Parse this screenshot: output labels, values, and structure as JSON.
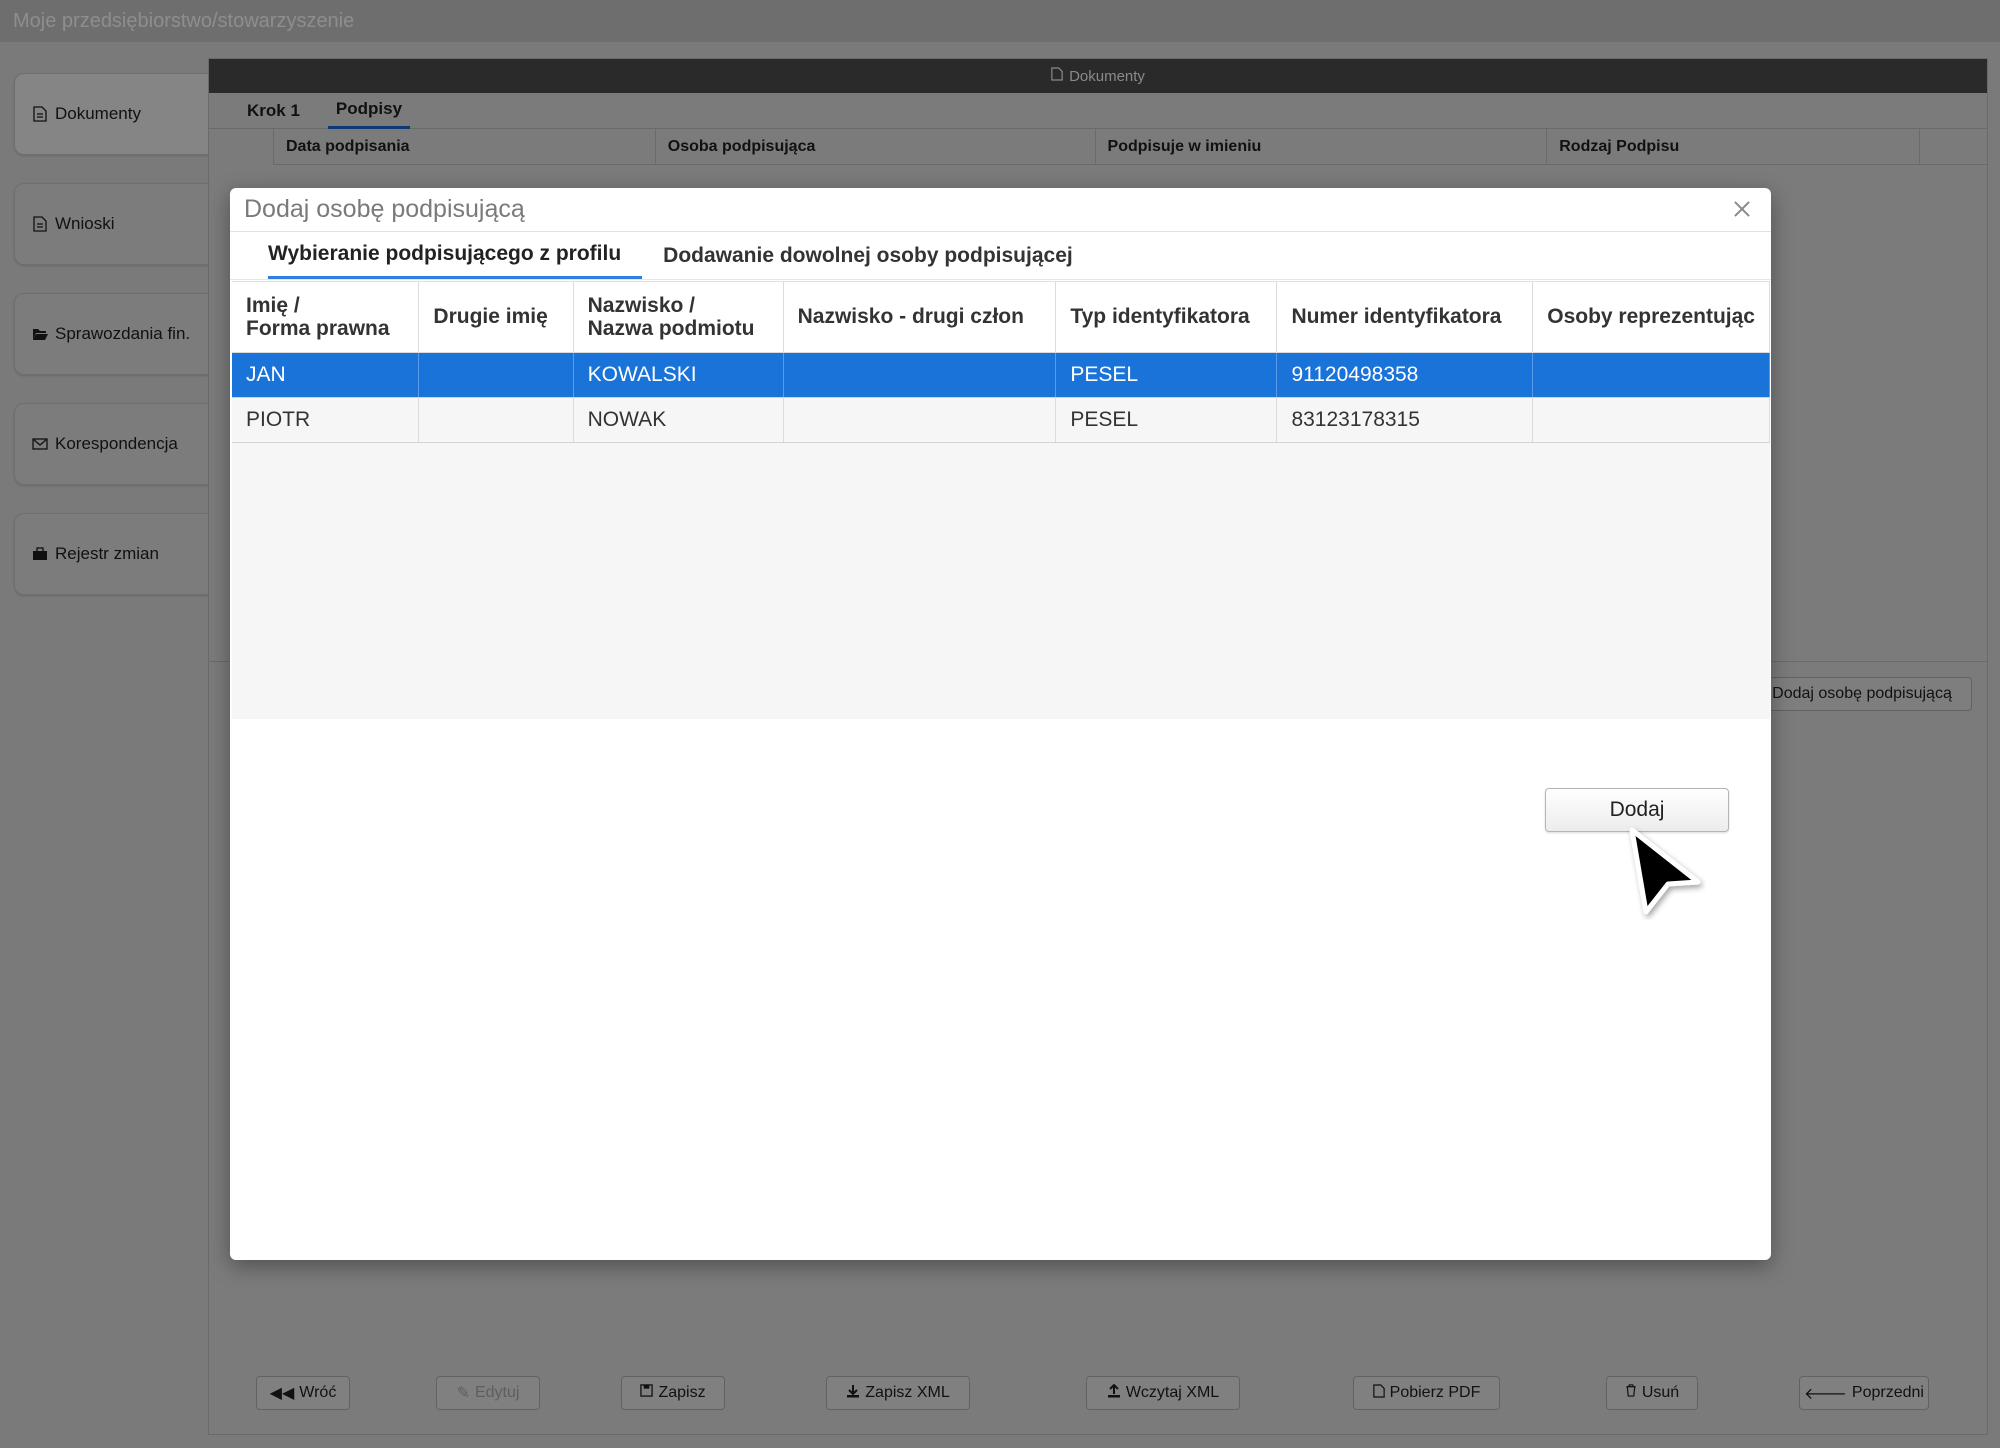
{
  "app": {
    "title": "Moje przedsiębiorstwo/stowarzyszenie"
  },
  "sidebar": {
    "items": [
      {
        "label": "Dokumenty",
        "icon": "document-icon"
      },
      {
        "label": "Wnioski",
        "icon": "document-icon"
      },
      {
        "label": "Sprawozdania fin.",
        "icon": "folder-open-icon"
      },
      {
        "label": "Korespondencja",
        "icon": "envelope-icon"
      },
      {
        "label": "Rejestr zmian",
        "icon": "briefcase-icon"
      }
    ]
  },
  "panel": {
    "header": "Dokumenty",
    "steps": [
      "Krok 1",
      "Podpisy"
    ],
    "active_step": "Podpisy",
    "columns": [
      "Data podpisania",
      "Osoba podpisująca",
      "Podpisuje w imieniu",
      "Rodzaj Podpisu"
    ],
    "add_signer_button": "Dodaj osobę podpisującą"
  },
  "footer": {
    "buttons": [
      {
        "label": "Wróć",
        "icon": "double-left-icon",
        "enabled": true
      },
      {
        "label": "Edytuj",
        "icon": "edit-icon",
        "enabled": false
      },
      {
        "label": "Zapisz",
        "icon": "save-icon",
        "enabled": true
      },
      {
        "label": "Zapisz XML",
        "icon": "download-icon",
        "enabled": true
      },
      {
        "label": "Wczytaj XML",
        "icon": "upload-icon",
        "enabled": true
      },
      {
        "label": "Pobierz PDF",
        "icon": "pdf-icon",
        "enabled": true
      },
      {
        "label": "Usuń",
        "icon": "trash-icon",
        "enabled": true
      },
      {
        "label": "Poprzedni",
        "icon": "arrow-left-icon",
        "enabled": true
      }
    ]
  },
  "modal": {
    "title": "Dodaj osobę podpisującą",
    "tabs": [
      "Wybieranie podpisującego z profilu",
      "Dodawanie dowolnej osoby podpisującej"
    ],
    "active_tab": "Wybieranie podpisującego z profilu",
    "table": {
      "headers": [
        [
          "Imię /",
          "Forma prawna"
        ],
        [
          "Drugie imię"
        ],
        [
          "Nazwisko /",
          "Nazwa podmiotu"
        ],
        [
          "Nazwisko - drugi człon"
        ],
        [
          "Typ identyfikatora"
        ],
        [
          "Numer identyfikatora"
        ],
        [
          "Osoby reprezentując"
        ]
      ],
      "rows": [
        [
          "JAN",
          "",
          "KOWALSKI",
          "",
          "PESEL",
          "91120498358",
          ""
        ],
        [
          "PIOTR",
          "",
          "NOWAK",
          "",
          "PESEL",
          "83123178315",
          ""
        ]
      ],
      "selected_row": 0
    },
    "add_button": "Dodaj"
  }
}
